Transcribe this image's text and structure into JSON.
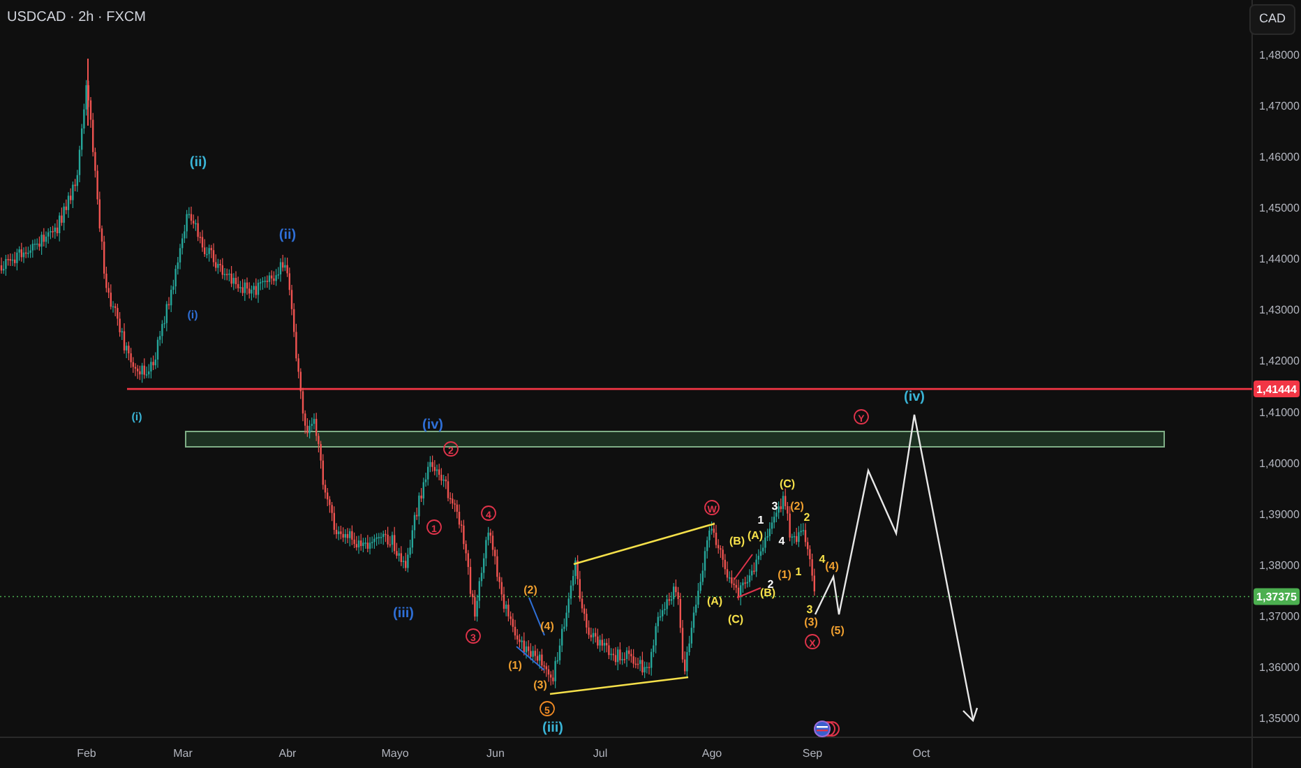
{
  "title": "USDCAD · 2h · FXCM",
  "currency": "CAD",
  "price_axis": [
    "1,48000",
    "1,47000",
    "1,46000",
    "1,45000",
    "1,44000",
    "1,43000",
    "1,42000",
    "1,41000",
    "1,40000",
    "1,39000",
    "1,38000",
    "1,37000",
    "1,36000",
    "1,35000"
  ],
  "time_axis": [
    "Feb",
    "Mar",
    "Abr",
    "Mayo",
    "Jun",
    "Jul",
    "Ago",
    "Sep",
    "Oct"
  ],
  "price_tags": [
    {
      "text": "1,41444",
      "color": "#f23645"
    },
    {
      "text": "1,37375",
      "color": "#4caf50"
    }
  ],
  "wave_labels": [
    {
      "text": "(i)",
      "color": "#3ab4d6",
      "circled": false
    },
    {
      "text": "(i)",
      "color": "#2f6fd6",
      "circled": false
    },
    {
      "text": "(ii)",
      "color": "#3ab4d6",
      "circled": false
    },
    {
      "text": "(ii)",
      "color": "#2f6fd6",
      "circled": false
    },
    {
      "text": "(iii)",
      "color": "#2f6fd6",
      "circled": false
    },
    {
      "text": "(iv)",
      "color": "#2f6fd6",
      "circled": false
    },
    {
      "text": "(iii)",
      "color": "#3ab4d6",
      "circled": false
    },
    {
      "text": "(iv)",
      "color": "#3ab4d6",
      "circled": false
    },
    {
      "text": "1",
      "color": "#e0344b",
      "circled": true
    },
    {
      "text": "2",
      "color": "#e0344b",
      "circled": true
    },
    {
      "text": "3",
      "color": "#e0344b",
      "circled": true
    },
    {
      "text": "4",
      "color": "#e0344b",
      "circled": true
    },
    {
      "text": "5",
      "color": "#f08a24",
      "circled": true
    },
    {
      "text": "W",
      "color": "#e0344b",
      "circled": true
    },
    {
      "text": "X",
      "color": "#e0344b",
      "circled": true
    },
    {
      "text": "Y",
      "color": "#e0344b",
      "circled": true
    },
    {
      "text": "(1)",
      "color": "#f0a030",
      "circled": false
    },
    {
      "text": "(2)",
      "color": "#f0a030",
      "circled": false
    },
    {
      "text": "(3)",
      "color": "#f0a030",
      "circled": false
    },
    {
      "text": "(4)",
      "color": "#f0a030",
      "circled": false
    },
    {
      "text": "(B)",
      "color": "#f5e04a",
      "circled": false
    },
    {
      "text": "(A)",
      "color": "#f5e04a",
      "circled": false
    },
    {
      "text": "(C)",
      "color": "#f5e04a",
      "circled": false
    },
    {
      "text": "(A)",
      "color": "#f5e04a",
      "circled": false
    },
    {
      "text": "(B)",
      "color": "#f5e04a",
      "circled": false
    },
    {
      "text": "(C)",
      "color": "#f5e04a",
      "circled": false
    },
    {
      "text": "3",
      "color": "#ffffff",
      "circled": false
    },
    {
      "text": "1",
      "color": "#ffffff",
      "circled": false
    },
    {
      "text": "4",
      "color": "#ffffff",
      "circled": false
    },
    {
      "text": "2",
      "color": "#ffffff",
      "circled": false
    },
    {
      "text": "(2)",
      "color": "#f0a030",
      "circled": false
    },
    {
      "text": "2",
      "color": "#f5e04a",
      "circled": false
    },
    {
      "text": "(1)",
      "color": "#f0a030",
      "circled": false
    },
    {
      "text": "1",
      "color": "#f5e04a",
      "circled": false
    },
    {
      "text": "4",
      "color": "#f5e04a",
      "circled": false
    },
    {
      "text": "3",
      "color": "#f5e04a",
      "circled": false
    },
    {
      "text": "(3)",
      "color": "#f0a030",
      "circled": false
    },
    {
      "text": "(4)",
      "color": "#f0a030",
      "circled": false
    },
    {
      "text": "(5)",
      "color": "#f0a030",
      "circled": false
    }
  ]
}
